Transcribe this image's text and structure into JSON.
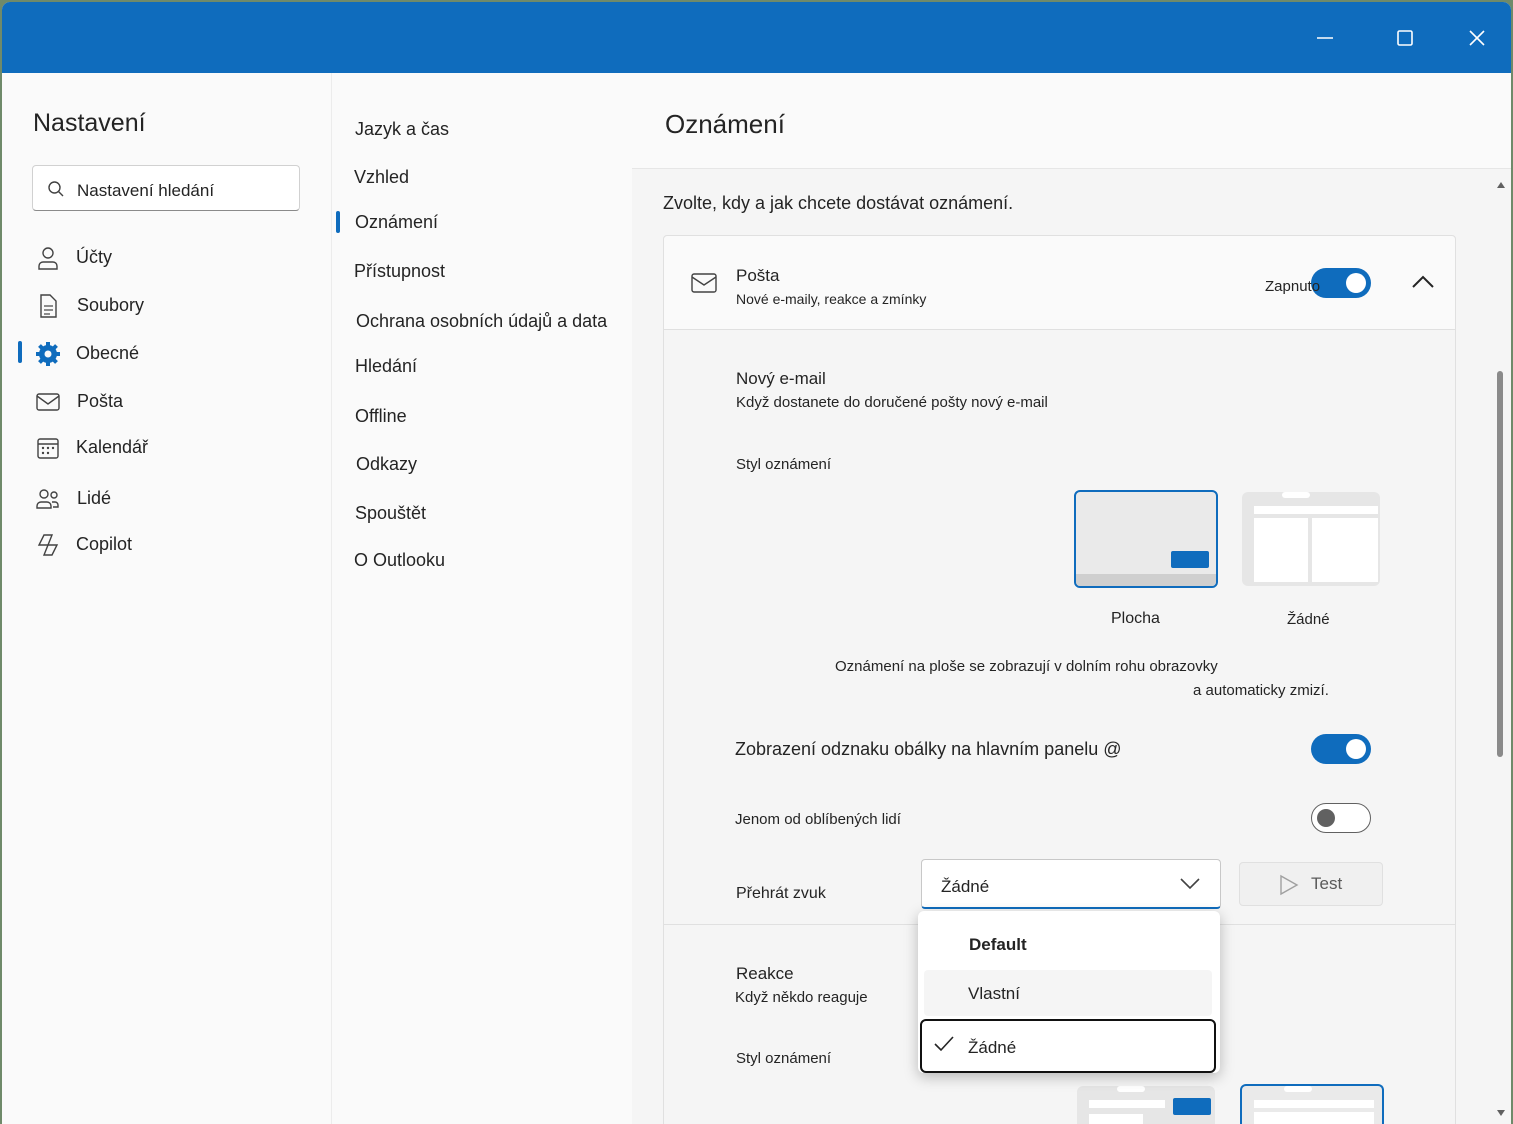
{
  "window": {
    "minimize_label": "",
    "maximize_label": "",
    "close_label": ""
  },
  "sidebar": {
    "title": "Nastavení",
    "search_placeholder": "Nastavení hledání",
    "items": [
      {
        "label": "Účty",
        "icon": "person-icon"
      },
      {
        "label": "Soubory",
        "icon": "document-icon"
      },
      {
        "label": "Obecné",
        "icon": "gear-icon",
        "selected": true
      },
      {
        "label": "Pošta",
        "icon": "mail-icon"
      },
      {
        "label": "Kalendář",
        "icon": "calendar-icon"
      },
      {
        "label": "Lidé",
        "icon": "people-icon"
      },
      {
        "label": "Copilot",
        "icon": "copilot-icon"
      }
    ]
  },
  "subnav": {
    "items": [
      {
        "label": "Jazyk a čas"
      },
      {
        "label": "Vzhled"
      },
      {
        "label": "Oznámení",
        "selected": true
      },
      {
        "label": "Přístupnost"
      },
      {
        "label": "Ochrana osobních údajů a data"
      },
      {
        "label": "Hledání"
      },
      {
        "label": "Offline"
      },
      {
        "label": "Odkazy"
      },
      {
        "label": "Spouštět"
      },
      {
        "label": "O Outlooku"
      }
    ]
  },
  "main": {
    "title": "Oznámení",
    "subtitle": "Zvolte, kdy a jak chcete dostávat oznámení.",
    "mail_card": {
      "title": "Pošta",
      "description": "Nové e-maily, reakce a zmínky",
      "toggle_label": "Zapnuto",
      "toggle_on": true,
      "new_email": {
        "title": "Nový e-mail",
        "description": "Když dostanete do doručené pošty nový e-mail",
        "style_label": "Styl oznámení",
        "options": [
          {
            "label": "Plocha",
            "selected": true
          },
          {
            "label": "Žádné",
            "selected": false
          }
        ],
        "hint_line1": "Oznámení na ploše se zobrazují v dolním rohu obrazovky",
        "hint_line2": "a automaticky zmizí.",
        "badge_label": "Zobrazení odznaku obálky na hlavním panelu @",
        "badge_on": true,
        "favorites_label": "Jenom od oblíbených lidí",
        "favorites_on": false,
        "sound_label": "Přehrát zvuk",
        "sound_value": "Žádné",
        "test_label": "Test",
        "sound_options": [
          {
            "label": "Default"
          },
          {
            "label": "Vlastní"
          },
          {
            "label": "Žádné",
            "selected": true
          }
        ]
      },
      "reactions": {
        "title": "Reakce",
        "description": "Když někdo reaguje",
        "style_label": "Styl oznámení"
      }
    }
  },
  "colors": {
    "accent": "#0f6cbd",
    "titlebar": "#0f6cbd"
  }
}
